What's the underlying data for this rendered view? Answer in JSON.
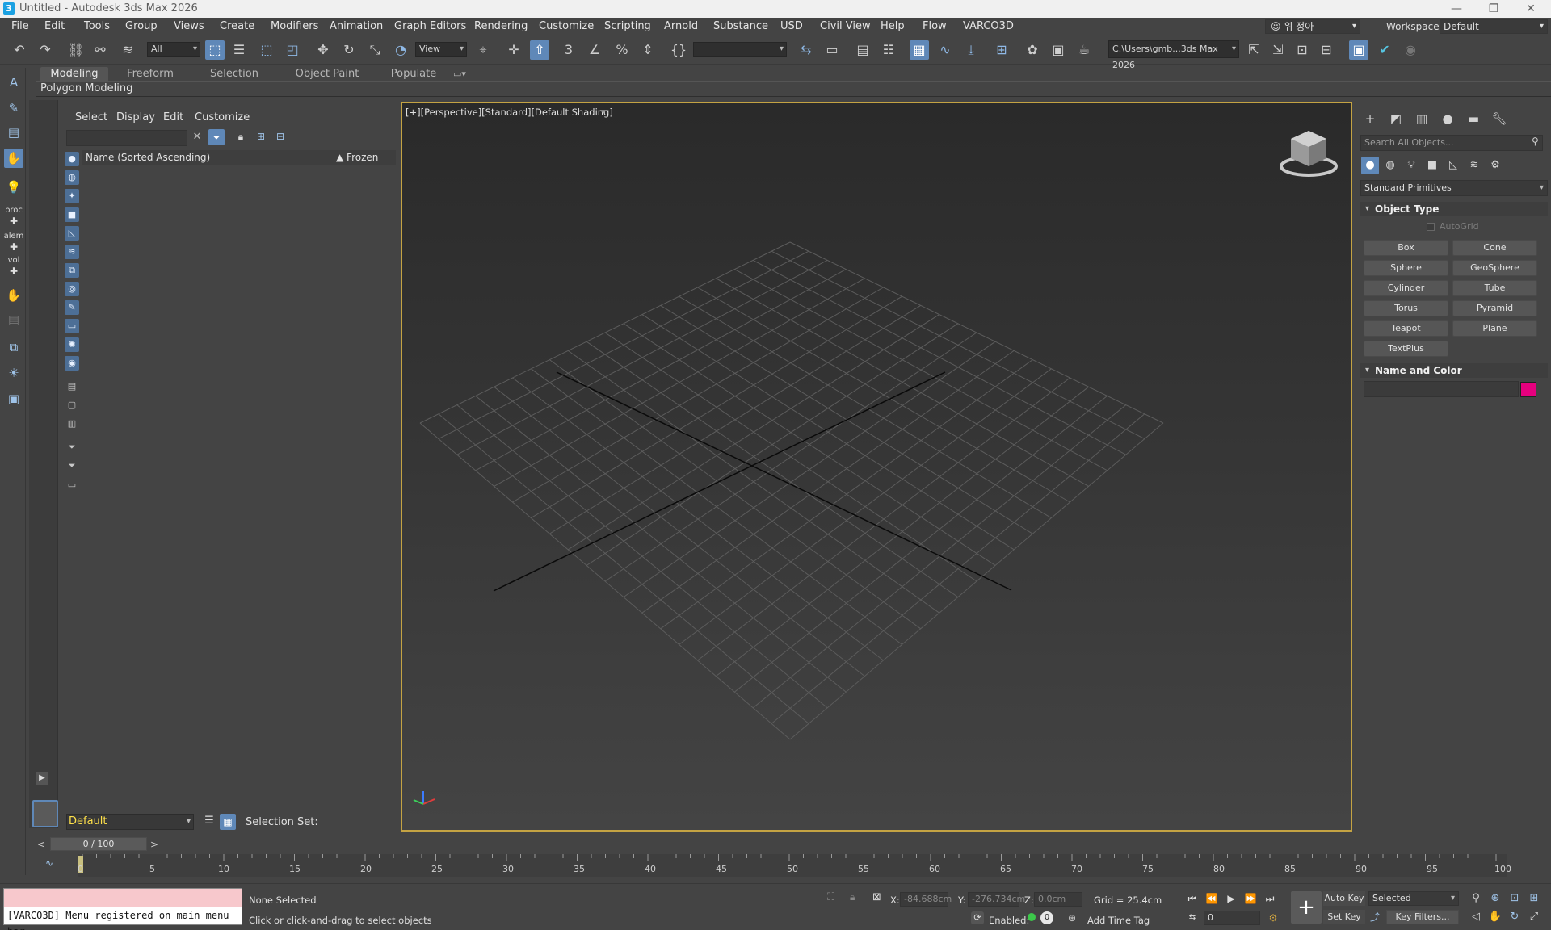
{
  "window": {
    "title": "Untitled - Autodesk 3ds Max 2026",
    "icon_letter": "3",
    "min_icon": "minimize-icon",
    "max_icon": "maximize-icon",
    "close_icon": "close-icon"
  },
  "menubar": {
    "items": [
      "File",
      "Edit",
      "Tools",
      "Group",
      "Views",
      "Create",
      "Modifiers",
      "Animation",
      "Graph Editors",
      "Rendering",
      "Customize",
      "Scripting",
      "Arnold",
      "Substance",
      "USD",
      "Civil View",
      "Help",
      "Flow",
      "VARCO3D"
    ],
    "user": "위 정아",
    "workspaces_label": "Workspaces:",
    "workspace_value": "Default"
  },
  "toolbar": {
    "selection_filter": "All",
    "ref_coord": "View",
    "named_selection": "",
    "project_path": "C:\\Users\\gmb...3ds Max 2026"
  },
  "ribbon": {
    "tabs": [
      "Modeling",
      "Freeform",
      "Selection",
      "Object Paint",
      "Populate"
    ],
    "active_tab": "Modeling",
    "panel_label": "Polygon Modeling"
  },
  "left_strip": {
    "labels": [
      "proc",
      "alem",
      "vol"
    ]
  },
  "scene_explorer": {
    "menus": [
      "Select",
      "Display",
      "Edit",
      "Customize"
    ],
    "search_value": "",
    "column_name": "Name (Sorted Ascending)",
    "column_frozen": "▲ Frozen",
    "layer_value": "Default",
    "selection_set_label": "Selection Set:"
  },
  "viewport": {
    "label": "[+][Perspective][Standard][Default Shading]"
  },
  "command_panel": {
    "search_placeholder": "Search All Objects...",
    "category": "Standard Primitives",
    "object_type_title": "Object Type",
    "autogrid_label": "AutoGrid",
    "buttons": [
      "Box",
      "Cone",
      "Sphere",
      "GeoSphere",
      "Cylinder",
      "Tube",
      "Torus",
      "Pyramid",
      "Teapot",
      "Plane",
      "TextPlus"
    ],
    "name_color_title": "Name and Color",
    "object_color": "#e6007e"
  },
  "timeline": {
    "slider_text": "0 / 100",
    "ticks": [
      "0",
      "5",
      "10",
      "15",
      "20",
      "25",
      "30",
      "35",
      "40",
      "45",
      "50",
      "55",
      "60",
      "65",
      "70",
      "75",
      "80",
      "85",
      "90",
      "95",
      "100"
    ]
  },
  "status": {
    "maxscript_output": "[VARCO3D] Menu registered on main menu bar",
    "selection_status": "None Selected",
    "prompt": "Click or click-and-drag to select objects",
    "x_label": "X:",
    "x_value": "-84.688cm",
    "y_label": "Y:",
    "y_value": "-276.734cm",
    "z_label": "Z:",
    "z_value": "0.0cm",
    "grid": "Grid = 25.4cm",
    "enabled_label": "Enabled:",
    "enabled_count": "0",
    "add_time_tag": "Add Time Tag",
    "auto_key": "Auto Key",
    "set_key": "Set Key",
    "key_mode": "Selected",
    "key_filters": "Key Filters...",
    "current_frame": "0"
  },
  "colors": {
    "accent": "#5f88b8",
    "viewport_border": "#c4a343",
    "layer_text": "#ffe14a"
  }
}
